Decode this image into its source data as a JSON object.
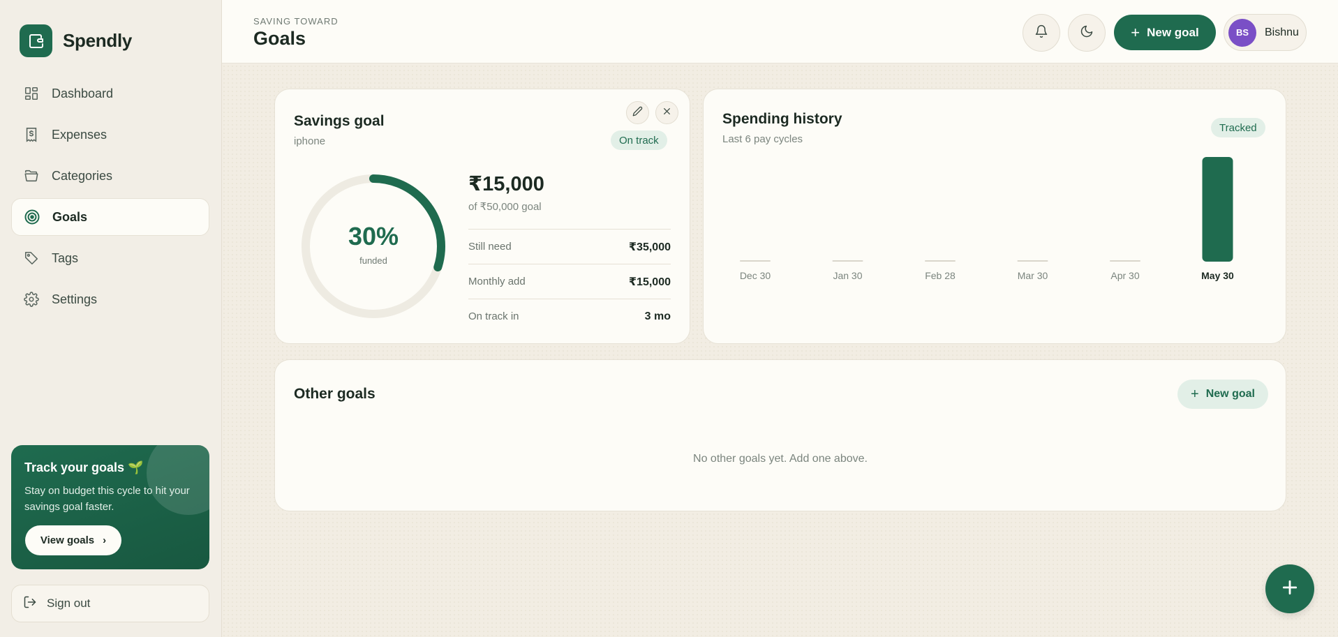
{
  "brand": {
    "name": "Spendly"
  },
  "sidebar": {
    "items": [
      {
        "label": "Dashboard",
        "icon": "grid-icon",
        "active": false
      },
      {
        "label": "Expenses",
        "icon": "receipt-icon",
        "active": false
      },
      {
        "label": "Categories",
        "icon": "folder-icon",
        "active": false
      },
      {
        "label": "Goals",
        "icon": "target-icon",
        "active": true
      },
      {
        "label": "Tags",
        "icon": "tag-icon",
        "active": false
      },
      {
        "label": "Settings",
        "icon": "gear-icon",
        "active": false
      }
    ],
    "promo": {
      "title": "Track your goals 🌱",
      "text": "Stay on budget this cycle to hit your savings goal faster.",
      "button": "View goals"
    },
    "signout": "Sign out"
  },
  "header": {
    "eyebrow": "SAVING TOWARD",
    "title": "Goals",
    "new_goal": "New goal",
    "user": {
      "initials": "BS",
      "name": "Bishnu"
    }
  },
  "savings_card": {
    "title": "Savings goal",
    "subtitle": "iphone",
    "status": "On track",
    "progress_percent": 30,
    "percent_label": "30%",
    "funded_label": "funded",
    "amount": "₹15,000",
    "amount_sub": "of ₹50,000 goal",
    "stats": [
      {
        "label": "Still need",
        "value": "₹35,000"
      },
      {
        "label": "Monthly add",
        "value": "₹15,000"
      },
      {
        "label": "On track in",
        "value": "3 mo"
      }
    ]
  },
  "history_card": {
    "title": "Spending history",
    "subtitle": "Last 6 pay cycles",
    "badge": "Tracked"
  },
  "chart_data": {
    "type": "bar",
    "title": "Spending history",
    "categories": [
      "Dec 30",
      "Jan 30",
      "Feb 28",
      "Mar 30",
      "Apr 30",
      "May 30"
    ],
    "values": [
      0,
      0,
      0,
      0,
      0,
      15000
    ],
    "highlight_index": 5,
    "xlabel": "",
    "ylabel": "",
    "grid": false
  },
  "other_goals": {
    "title": "Other goals",
    "button": "New goal",
    "empty": "No other goals yet. Add one above."
  },
  "colors": {
    "accent": "#1f6b4f",
    "accent_soft": "#e2efe7",
    "ring_track": "#eeebe2",
    "avatar": "#7a4fc6",
    "background": "#f3efe6",
    "card": "#fdfcf7"
  }
}
